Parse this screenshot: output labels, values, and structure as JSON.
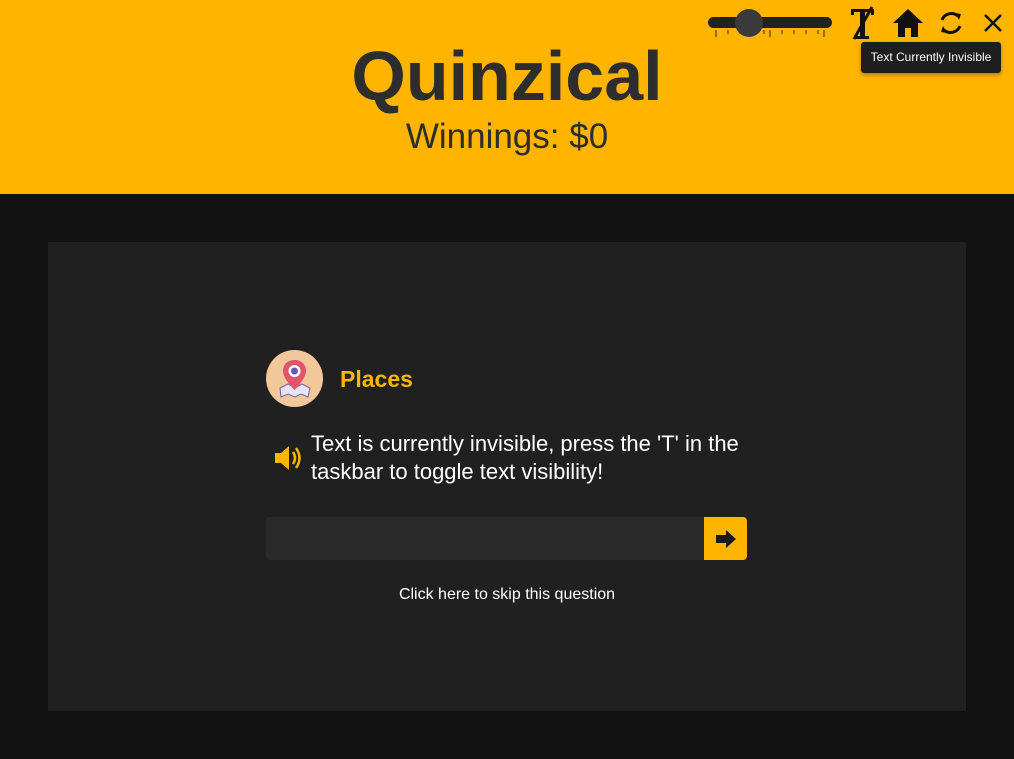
{
  "header": {
    "title": "Quinzical",
    "winnings": "Winnings: $0",
    "background_color": "#ffb400"
  },
  "toolbar": {
    "speed_slider": {
      "value": 0.2
    },
    "buttons": [
      {
        "name": "text-toggle",
        "icon": "text-strikethrough-icon"
      },
      {
        "name": "home",
        "icon": "home-icon"
      },
      {
        "name": "refresh",
        "icon": "refresh-icon"
      },
      {
        "name": "close",
        "icon": "close-icon"
      }
    ],
    "tooltip": "Text Currently Invisible"
  },
  "question": {
    "category": "Places",
    "category_icon": "map-pin-icon",
    "text": "Text is currently invisible, press the 'T' in the taskbar to toggle text visibility!",
    "answer_value": "",
    "speaker_icon": "speaker-icon",
    "submit_icon": "arrow-right-icon",
    "skip_label": "Click here to skip this question"
  },
  "colors": {
    "accent": "#ffb400",
    "panel": "#202020",
    "background": "#121212",
    "dark_text": "#2d2d2d"
  }
}
